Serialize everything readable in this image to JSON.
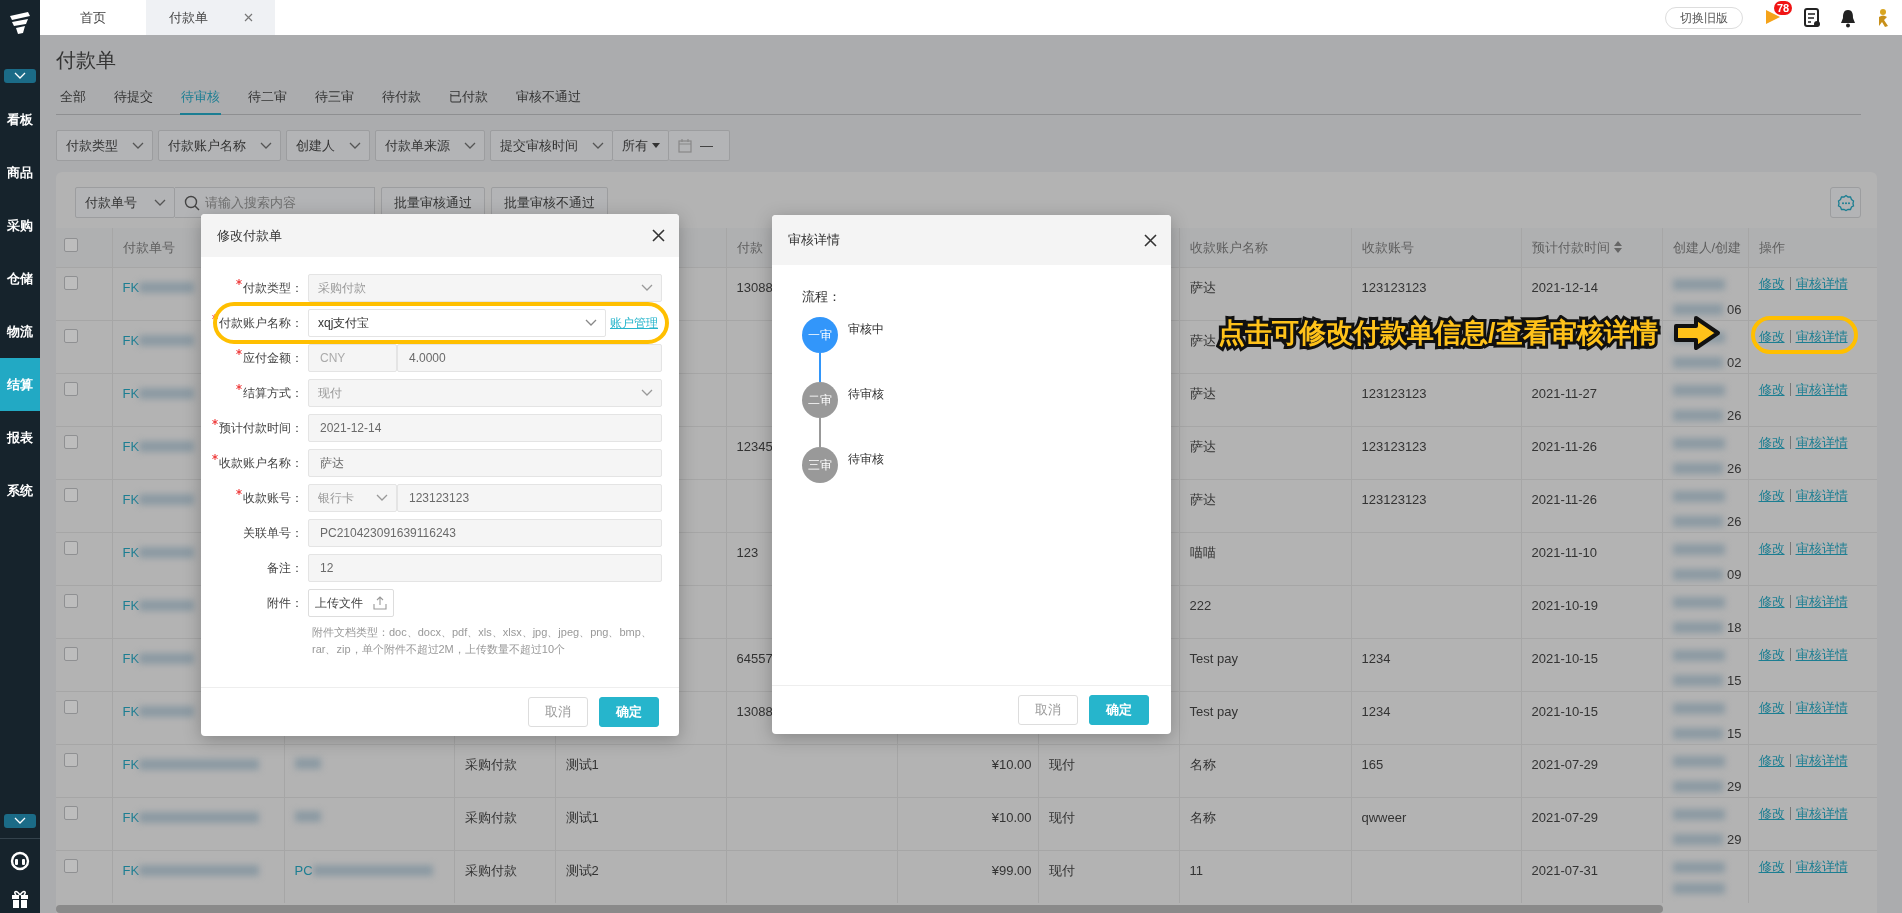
{
  "sidebar": {
    "items": [
      {
        "label": "看板",
        "selected": false
      },
      {
        "label": "商品",
        "selected": false
      },
      {
        "label": "采购",
        "selected": false
      },
      {
        "label": "仓储",
        "selected": false
      },
      {
        "label": "物流",
        "selected": false
      },
      {
        "label": "结算",
        "selected": true
      },
      {
        "label": "报表",
        "selected": false
      },
      {
        "label": "系统",
        "selected": false
      }
    ]
  },
  "top_tabs": [
    {
      "label": "首页",
      "selected": false,
      "closable": false
    },
    {
      "label": "付款单",
      "selected": true,
      "closable": true
    }
  ],
  "header_actions": {
    "switch_button": "切换旧版",
    "flag_badge": "78"
  },
  "page_title": "付款单",
  "status_tabs": [
    {
      "label": "全部",
      "selected": false
    },
    {
      "label": "待提交",
      "selected": false
    },
    {
      "label": "待审核",
      "selected": true
    },
    {
      "label": "待二审",
      "selected": false
    },
    {
      "label": "待三审",
      "selected": false
    },
    {
      "label": "待付款",
      "selected": false
    },
    {
      "label": "已付款",
      "selected": false
    },
    {
      "label": "审核不通过",
      "selected": false
    }
  ],
  "filters": [
    {
      "label": "付款类型"
    },
    {
      "label": "付款账户名称"
    },
    {
      "label": "创建人"
    },
    {
      "label": "付款单来源"
    }
  ],
  "time_filter": {
    "label": "提交审核时间",
    "range": "所有",
    "separator": "—"
  },
  "search": {
    "field_select": "付款单号",
    "placeholder": "请输入搜索内容"
  },
  "batch_buttons": [
    "批量审核通过",
    "批量审核不通过"
  ],
  "table": {
    "select_all": {
      "checked": false
    },
    "columns": [
      {
        "kind": "text",
        "label": "付款单号"
      },
      {
        "kind": "text"
      },
      {
        "kind": "text"
      },
      {
        "kind": "text"
      },
      {
        "kind": "text",
        "label": "付款"
      },
      {
        "kind": "amount"
      },
      {
        "kind": "text"
      },
      {
        "kind": "text",
        "label": "收款账户名称"
      },
      {
        "kind": "text",
        "label": "收款账号"
      },
      {
        "kind": "text",
        "label": "预计付款时间",
        "sortable": true
      },
      {
        "kind": "creator",
        "label": "创建人/创建"
      },
      {
        "kind": "actions",
        "label": "操作"
      }
    ],
    "rows": [
      {
        "checked": false,
        "highlighted": false,
        "cells": [
          {
            "text": "FK",
            "blurred": true
          },
          "",
          "",
          "",
          "13088",
          "",
          "",
          "萨达",
          "123123123",
          "2021-12-14",
          {
            "text": "06",
            "blurred": true
          },
          {
            "actions": [
              "修改",
              "审核详情"
            ]
          }
        ]
      },
      {
        "checked": false,
        "highlighted": true,
        "cells": [
          {
            "text": "FK",
            "blurred": true
          },
          "",
          "",
          "",
          "",
          "",
          "",
          "萨达",
          "",
          "",
          {
            "text": "02",
            "blurred": true
          },
          {
            "actions": [
              "修改",
              "审核详情"
            ]
          }
        ]
      },
      {
        "checked": false,
        "highlighted": false,
        "cells": [
          {
            "text": "FK",
            "blurred": true
          },
          "",
          "",
          "",
          "",
          "",
          "",
          "萨达",
          "123123123",
          "2021-11-27",
          {
            "text": "26",
            "blurred": true
          },
          {
            "actions": [
              "修改",
              "审核详情"
            ]
          }
        ]
      },
      {
        "checked": false,
        "highlighted": false,
        "cells": [
          {
            "text": "FK",
            "blurred": true
          },
          "",
          "",
          "",
          "12345",
          "",
          "",
          "萨达",
          "123123123",
          "2021-11-26",
          {
            "text": "26",
            "blurred": true
          },
          {
            "actions": [
              "修改",
              "审核详情"
            ]
          }
        ]
      },
      {
        "checked": false,
        "highlighted": false,
        "cells": [
          {
            "text": "FK",
            "blurred": true
          },
          "",
          "",
          "",
          "",
          "",
          "",
          "萨达",
          "123123123",
          "2021-11-26",
          {
            "text": "26",
            "blurred": true
          },
          {
            "actions": [
              "修改",
              "审核详情"
            ]
          }
        ]
      },
      {
        "checked": false,
        "highlighted": false,
        "cells": [
          {
            "text": "FK",
            "blurred": true
          },
          "",
          "",
          "",
          "123",
          "",
          "",
          "喵喵",
          "",
          "2021-11-10",
          {
            "text": "09",
            "blurred": true
          },
          {
            "actions": [
              "修改",
              "审核详情"
            ]
          }
        ]
      },
      {
        "checked": false,
        "highlighted": false,
        "cells": [
          {
            "text": "FK",
            "blurred": true
          },
          "",
          "",
          "",
          "",
          "",
          "",
          "222",
          "",
          "2021-10-19",
          {
            "text": "18",
            "blurred": true
          },
          {
            "actions": [
              "修改",
              "审核详情"
            ]
          }
        ]
      },
      {
        "checked": false,
        "highlighted": false,
        "cells": [
          {
            "text": "FK",
            "blurred": true
          },
          "",
          "",
          "",
          "64557",
          "",
          "",
          "Test pay",
          "1234",
          "2021-10-15",
          {
            "text": "15",
            "blurred": true
          },
          {
            "actions": [
              "修改",
              "审核详情"
            ]
          }
        ]
      },
      {
        "checked": false,
        "highlighted": false,
        "cells": [
          {
            "text": "FK",
            "blurred": true
          },
          "",
          "",
          "",
          "13088",
          "",
          "",
          "Test pay",
          "1234",
          "2021-10-15",
          {
            "text": "15",
            "blurred": true
          },
          {
            "actions": [
              "修改",
              "审核详情"
            ]
          }
        ]
      },
      {
        "checked": false,
        "highlighted": false,
        "cells": [
          {
            "text": "FK",
            "blurred": true
          },
          {
            "blurred": true
          },
          "采购付款",
          "测试1",
          "",
          "¥10.00",
          "现付",
          "名称",
          "165",
          "2021-07-29",
          {
            "text": "29",
            "blurred": true
          },
          {
            "actions": [
              "修改",
              "审核详情"
            ]
          }
        ]
      },
      {
        "checked": false,
        "highlighted": false,
        "cells": [
          {
            "text": "FK",
            "blurred": true
          },
          {
            "blurred": true
          },
          "采购付款",
          "测试1",
          "",
          "¥10.00",
          "现付",
          "名称",
          "qwweer",
          "2021-07-29",
          {
            "text": "29",
            "blurred": true
          },
          {
            "actions": [
              "修改",
              "审核详情"
            ]
          }
        ]
      },
      {
        "checked": false,
        "highlighted": false,
        "cells": [
          {
            "text": "FK",
            "blurred": true
          },
          {
            "text": "PC",
            "blurred": true
          },
          "采购付款",
          "测试2",
          "",
          "¥99.00",
          "现付",
          "11",
          "",
          "2021-07-31",
          {
            "blurred": true
          },
          {
            "actions": [
              "修改",
              "审核详情"
            ]
          }
        ]
      }
    ]
  },
  "edit_modal": {
    "title": "修改付款单",
    "fields": [
      {
        "kind": "select",
        "label": "付款类型：",
        "required": true,
        "value": "采购付款",
        "disabled": true,
        "highlighted": false
      },
      {
        "kind": "select",
        "label": "付款账户名称：",
        "required": true,
        "value": "xqj支付宝",
        "disabled": false,
        "link": "账户管理",
        "highlighted": true
      },
      {
        "kind": "pair",
        "label": "应付金额：",
        "required": true,
        "first": "CNY",
        "value": "4.0000",
        "disabled": true,
        "highlighted": false
      },
      {
        "kind": "select",
        "label": "结算方式：",
        "required": true,
        "value": "现付",
        "disabled": true,
        "highlighted": false
      },
      {
        "kind": "text",
        "label": "预计付款时间：",
        "required": true,
        "value": "2021-12-14",
        "disabled": true,
        "highlighted": false
      },
      {
        "kind": "text",
        "label": "收款账户名称：",
        "required": true,
        "value": "萨达",
        "disabled": true,
        "highlighted": false
      },
      {
        "kind": "select_pair",
        "label": "收款账号：",
        "required": true,
        "first": "银行卡",
        "value": "123123123",
        "disabled": true,
        "highlighted": false
      },
      {
        "kind": "text",
        "label": "关联单号：",
        "required": false,
        "value": "PC210423091639116243",
        "disabled": true,
        "highlighted": false
      },
      {
        "kind": "text",
        "label": "备注：",
        "required": false,
        "value": "12",
        "disabled": true,
        "highlighted": false
      },
      {
        "kind": "upload",
        "label": "附件：",
        "required": false,
        "button": "上传文件",
        "hint": "附件文档类型：doc、docx、pdf、xls、xlsx、jpg、jpeg、png、bmp、rar、zip，单个附件不超过2M，上传数量不超过10个",
        "highlighted": false
      }
    ],
    "buttons": [
      {
        "label": "取消",
        "kind": "secondary"
      },
      {
        "label": "确定",
        "kind": "primary"
      }
    ]
  },
  "audit_modal": {
    "title": "审核详情",
    "flow_label": "流程：",
    "steps": [
      {
        "badge": "一审",
        "status": "审核中",
        "active": true
      },
      {
        "badge": "二审",
        "status": "待审核",
        "active": false
      },
      {
        "badge": "三审",
        "status": "待审核",
        "active": false
      }
    ],
    "buttons": [
      {
        "label": "取消",
        "kind": "secondary"
      },
      {
        "label": "确定",
        "kind": "primary"
      }
    ]
  },
  "annotation": {
    "text": "点击可修改付款单信息/查看审核详情"
  }
}
